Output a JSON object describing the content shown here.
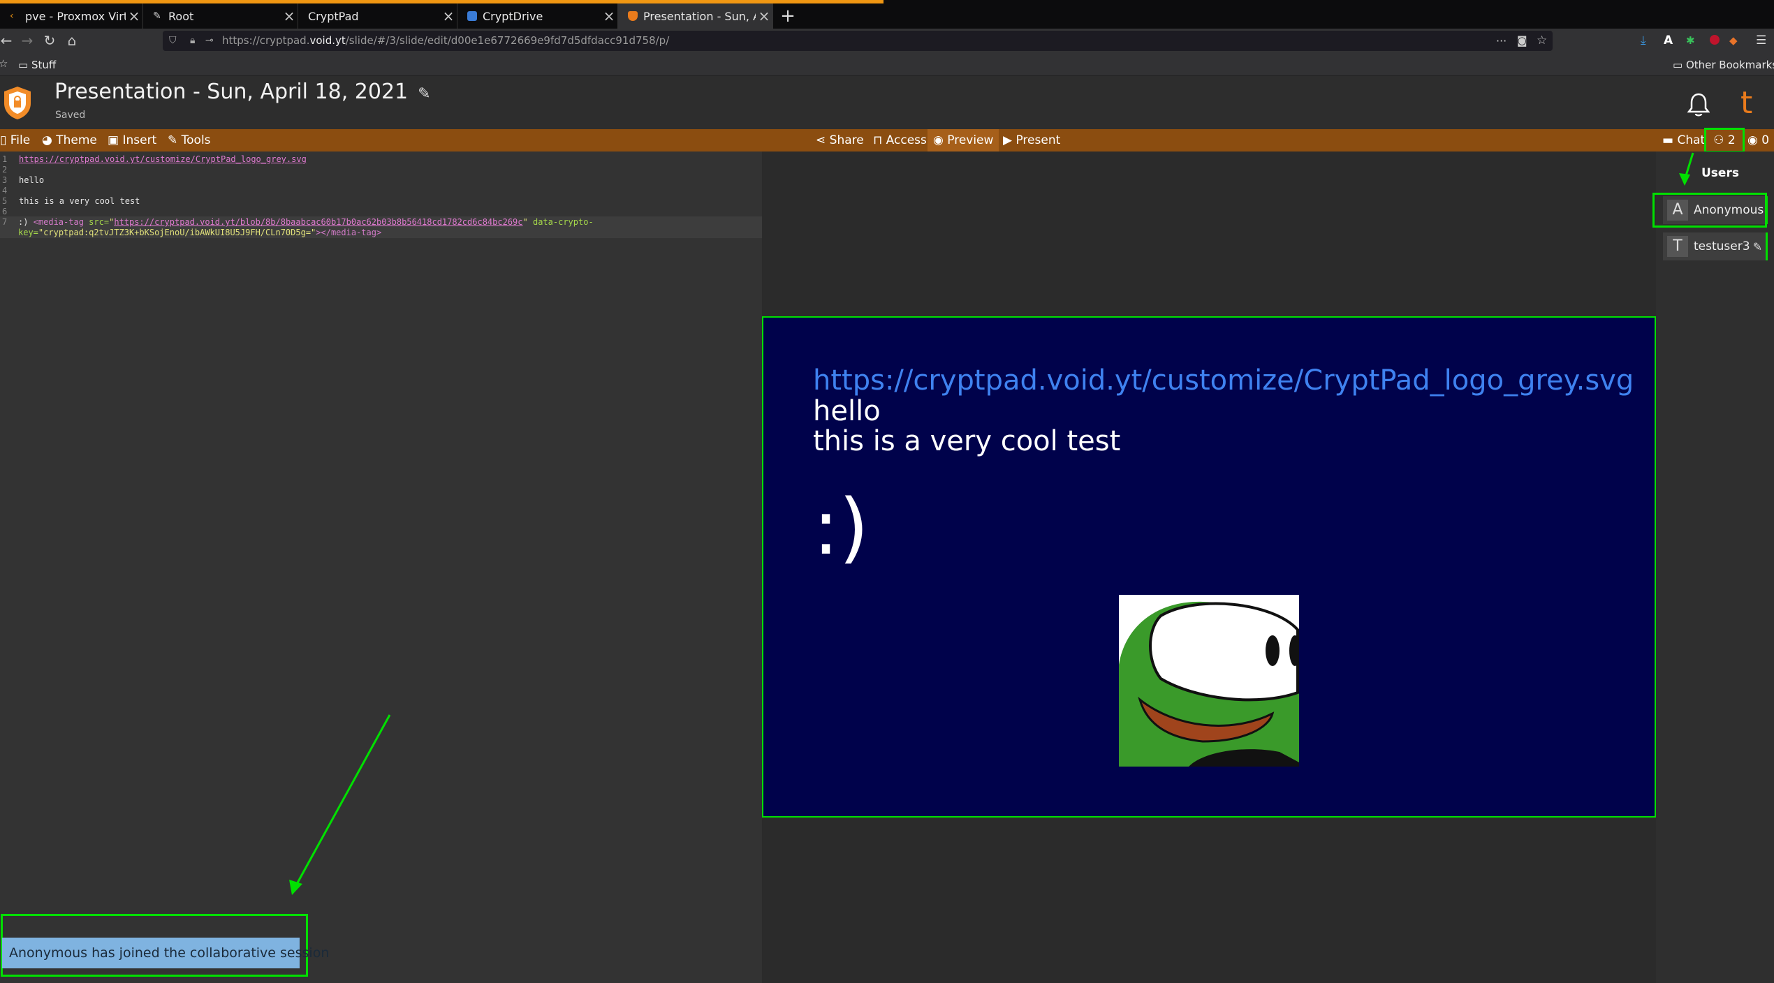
{
  "browser": {
    "tabs": [
      {
        "label": "pve - Proxmox Virtual Er",
        "active": false
      },
      {
        "label": "Root",
        "active": false
      },
      {
        "label": "CryptPad",
        "active": false
      },
      {
        "label": "CryptDrive",
        "active": false
      },
      {
        "label": "Presentation - Sun, April",
        "active": true
      }
    ],
    "new_tab": "+",
    "url_prefix": "https://cryptpad.",
    "url_domain": "void.yt",
    "url_path": "/slide/#/3/slide/edit/d00e1e6772669e9fd7d5dfdacc91d758/p/",
    "url_more": "···",
    "bookmarks": {
      "folder": "Stuff",
      "other": "Other Bookmarks"
    }
  },
  "app": {
    "title": "Presentation - Sun, April 18, 2021",
    "status": "Saved",
    "user_initial": "t"
  },
  "toolbar": {
    "file": "File",
    "theme": "Theme",
    "insert": "Insert",
    "tools": "Tools",
    "share": "Share",
    "access": "Access",
    "preview": "Preview",
    "present": "Present",
    "chat": "Chat",
    "users_count": "2",
    "viewers_count": "0"
  },
  "editor": {
    "line_numbers": [
      "1",
      "2",
      "3",
      "4",
      "5",
      "6",
      "7"
    ],
    "line1": "https://cryptpad.void.yt/customize/CryptPad_logo_grey.svg",
    "line3": "hello",
    "line5": "this is a very cool test",
    "line7_smiley": ":)",
    "line7_tag_open": "<media-tag",
    "line7_src_attr": "src=",
    "line7_src": "https://cryptpad.void.yt/blob/8b/8baabcac60b17b0ac62b03b8b56418cd1782cd6c84bc269c",
    "line7_crypto_attr": "data-crypto-",
    "line7_key_attr": "key=",
    "line7_key": "cryptpad:q2tvJTZ3K+bKSojEnoU/ibAWkUI8U5J9FH/CLn70D5g=",
    "line7_tag_close": "></media-tag>"
  },
  "slide": {
    "link": "https://cryptpad.void.yt/customize/CryptPad_logo_grey.svg",
    "line1": "hello",
    "line2": "this is a very cool test",
    "smiley": ":)"
  },
  "users": {
    "heading": "Users",
    "list": [
      {
        "initial": "A",
        "name": "Anonymous"
      },
      {
        "initial": "T",
        "name": "testuser3"
      }
    ]
  },
  "notification": "Anonymous has joined the collaborative session",
  "colors": {
    "toolbar": "#8b4d10",
    "slide_bg": "#00024b",
    "annotation": "#00e000",
    "slide_link": "#3f82f0"
  }
}
